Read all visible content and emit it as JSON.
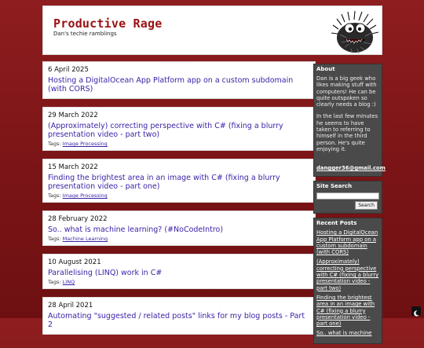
{
  "site": {
    "title": "Productive Rage",
    "tagline": "Dan's techie ramblings"
  },
  "posts": [
    {
      "date": "6 April 2025",
      "title": "Hosting a DigitalOcean App Platform app on a custom subdomain (with CORS)",
      "tags_label": "",
      "tags": []
    },
    {
      "date": "29 March 2022",
      "title": "(Approximately) correcting perspective with C# (fixing a blurry presentation video - part two)",
      "tags_label": "Tags:",
      "tags": [
        "Image Processing"
      ]
    },
    {
      "date": "15 March 2022",
      "title": "Finding the brightest area in an image with C# (fixing a blurry presentation video - part one)",
      "tags_label": "Tags:",
      "tags": [
        "Image Processing"
      ]
    },
    {
      "date": "28 February 2022",
      "title": "So.. what is machine learning? (#NoCodeIntro)",
      "tags_label": "Tags:",
      "tags": [
        "Machine Learning"
      ]
    },
    {
      "date": "10 August 2021",
      "title": "Parallelising (LINQ) work in C#",
      "tags_label": "Tags:",
      "tags": [
        "LINQ"
      ]
    },
    {
      "date": "28 April 2021",
      "title": "Automating \"suggested / related posts\" links for my blog posts - Part 2",
      "tags_label": "",
      "tags": []
    }
  ],
  "sidebar": {
    "about": {
      "heading": "About",
      "para1": "Dan is a big geek who likes making stuff with computers! He can be quite outspoken so clearly needs a blog :)",
      "para2": "In the last few minutes he seems to have taken to referring to himself in the third person. He's quite enjoying it.",
      "email": "dangger36@gmail.com"
    },
    "search": {
      "heading": "Site Search",
      "input_value": "",
      "button_label": "Search"
    },
    "recent": {
      "heading": "Recent Posts",
      "items": [
        "Hosting a DigitalOcean App Platform app on a custom subdomain (with CORS)",
        "(Approximately) correcting perspective with C# (fixing a blurry presentation video - part two)",
        "Finding the brightest area in an image with C# (fixing a blurry presentation video - part one)",
        "So.. what is machine"
      ]
    }
  },
  "colors": {
    "background": "#8e1d1f",
    "title": "#9b1111",
    "link": "#3a1ea5",
    "sidebar_box": "#4a4a4a"
  },
  "icons": {
    "mascot": "mascot-image",
    "theme": "moon-icon"
  }
}
